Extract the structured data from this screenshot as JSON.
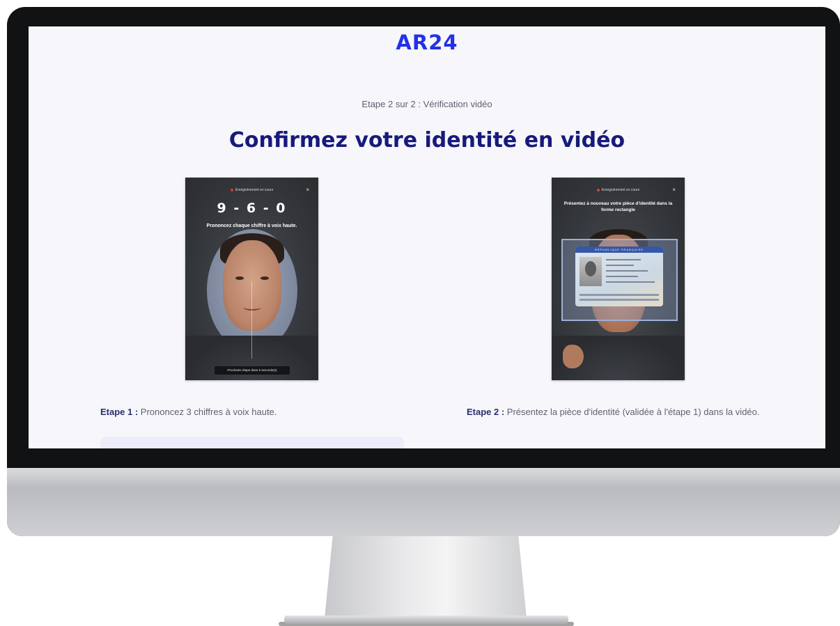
{
  "app": {
    "logo": "AR24",
    "step_indicator": "Etape 2 sur 2 : Vérification vidéo",
    "title": "Confirmez votre identité en vidéo"
  },
  "preview_1": {
    "recording_label": "Enregistrement en cours",
    "close_symbol": "×",
    "digits": "9 - 6 - 0",
    "instruction": "Prononcez chaque chiffre à voix haute.",
    "next_step": "Prochaine étape dans 5 seconde(s)"
  },
  "preview_2": {
    "recording_label": "Enregistrement en cours",
    "close_symbol": "×",
    "instruction": "Présentez à nouveau votre pièce d'identité dans la forme rectangle",
    "card_header": "RÉPUBLIQUE FRANÇAISE"
  },
  "steps": [
    {
      "label": "Etape 1 :",
      "text": " Prononcez 3 chiffres à voix haute."
    },
    {
      "label": "Etape 2 :",
      "text": " Présentez la pièce d'identité (validée à l'étape 1) dans la vidéo."
    }
  ],
  "colors": {
    "brand": "#2330ea",
    "title": "#171a7a",
    "screen_bg": "#f6f6fb",
    "recording_dot": "#e23a3a"
  },
  "icons": {
    "close": "close-icon",
    "recording": "recording-dot-icon"
  }
}
